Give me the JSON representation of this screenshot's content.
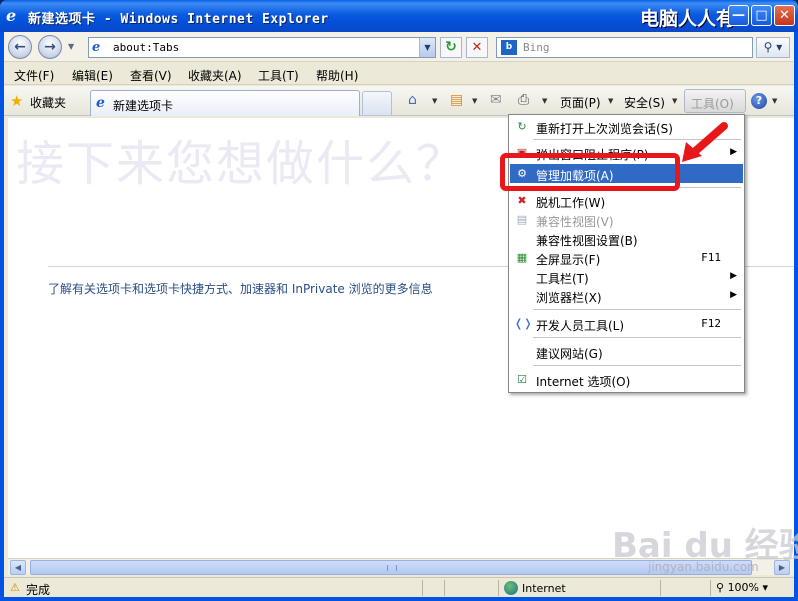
{
  "window": {
    "title": "新建选项卡 - Windows Internet Explorer",
    "watermark": "电脑人人有"
  },
  "address_bar": {
    "url": "about:Tabs",
    "search_placeholder": "Bing"
  },
  "menu_bar": {
    "items": [
      "文件(F)",
      "编辑(E)",
      "查看(V)",
      "收藏夹(A)",
      "工具(T)",
      "帮助(H)"
    ]
  },
  "command_bar": {
    "favorites_label": "收藏夹",
    "tab_label": "新建选项卡",
    "page_label": "页面(P)",
    "safety_label": "安全(S)",
    "tools_label": "工具(O)"
  },
  "content": {
    "heading": "接下来您想做什么？",
    "info_link": "了解有关选项卡和选项卡快捷方式、加速器和 InPrivate 浏览的更多信息"
  },
  "tools_menu": {
    "items": [
      {
        "label": "重新打开上次浏览会话(S)",
        "icon": "reopen-session-icon"
      },
      {
        "label": "弹出窗口阻止程序(P)",
        "icon": "popup-blocker-icon",
        "submenu": true
      },
      {
        "label": "管理加载项(A)",
        "icon": "addons-icon",
        "highlighted": true
      },
      {
        "label": "脱机工作(W)",
        "icon": "offline-icon"
      },
      {
        "label": "兼容性视图(V)",
        "icon": "compat-view-icon",
        "disabled": true
      },
      {
        "label": "兼容性视图设置(B)",
        "icon": ""
      },
      {
        "label": "全屏显示(F)",
        "icon": "fullscreen-icon",
        "shortcut": "F11"
      },
      {
        "label": "工具栏(T)",
        "icon": "",
        "submenu": true
      },
      {
        "label": "浏览器栏(X)",
        "icon": "",
        "submenu": true
      },
      {
        "label": "开发人员工具(L)",
        "icon": "developer-tools-icon",
        "shortcut": "F12"
      },
      {
        "label": "建议网站(G)",
        "icon": ""
      },
      {
        "label": "Internet 选项(O)",
        "icon": "internet-options-icon"
      }
    ]
  },
  "status_bar": {
    "status": "完成",
    "zone": "Internet",
    "zoom": "100%"
  },
  "watermarks": {
    "baidu": "Bai du 经验",
    "jingyan": "jingyan.baidu.com"
  },
  "colors": {
    "highlight": "#316ac5",
    "annotation_red": "#e8181a",
    "titlebar": "#0a5be0"
  }
}
